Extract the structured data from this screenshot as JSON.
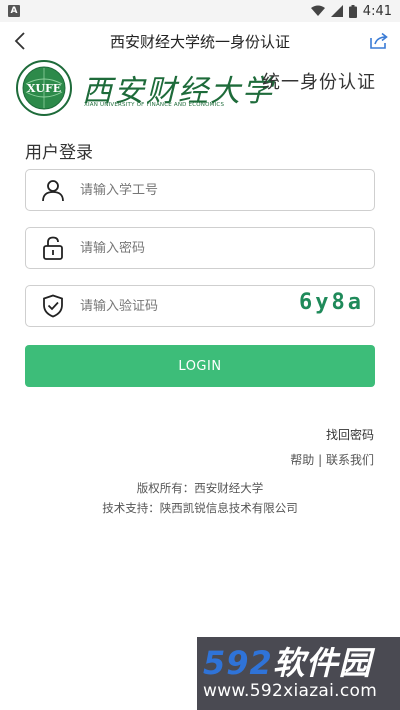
{
  "status_bar": {
    "notification_badge": "A",
    "time": "4:41"
  },
  "nav": {
    "title": "西安财经大学统一身份认证"
  },
  "header": {
    "seal_text": "XUFE",
    "university_name": "西安财经大学",
    "university_name_en": "XIAN UNIVERSITY OF FINANCE AND ECONOMICS",
    "auth_title": "统一身份认证"
  },
  "login": {
    "heading": "用户登录",
    "username_placeholder": "请输入学工号",
    "password_placeholder": "请输入密码",
    "captcha_placeholder": "请输入验证码",
    "captcha_code": "6y8a",
    "submit_label": "LOGIN"
  },
  "links": {
    "forgot": "找回密码",
    "help": "帮助",
    "separator": "|",
    "contact": "联系我们"
  },
  "footer": {
    "copyright": "版权所有：西安财经大学",
    "support": "技术支持：陕西凯锐信息技术有限公司"
  },
  "watermark": {
    "number": "592",
    "name": "软件园",
    "url": "www.592xiazai.com"
  },
  "colors": {
    "primary": "#3dbd79",
    "brand_green": "#1e6b3a",
    "captcha": "#1f8a5a"
  }
}
